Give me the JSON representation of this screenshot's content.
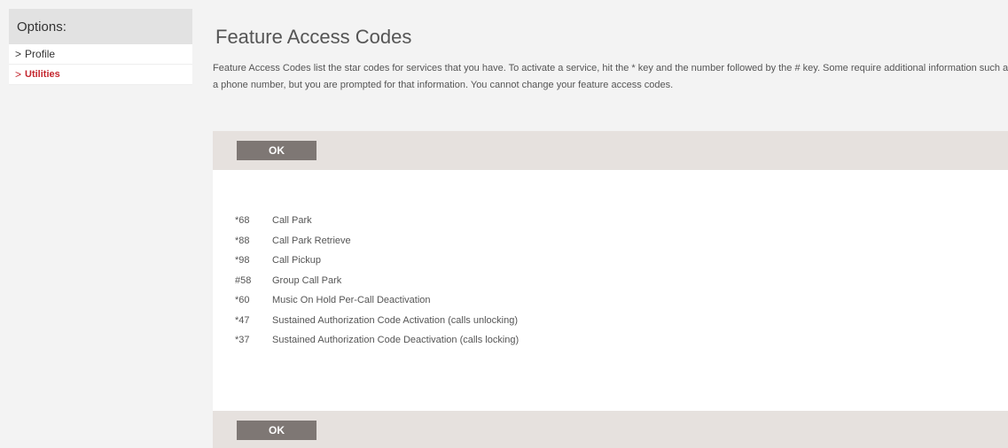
{
  "sidebar": {
    "header": "Options:",
    "items": [
      {
        "label": "Profile",
        "active": false
      },
      {
        "label": "Utilities",
        "active": true
      }
    ]
  },
  "main": {
    "title": "Feature Access Codes",
    "description": "Feature Access Codes list the star codes for services that you have. To activate a service, hit the * key and the number followed by the # key. Some require additional information such as a phone number, but you are prompted for that information. You cannot change your feature access codes.",
    "ok_label": "OK",
    "codes": [
      {
        "code": "*68",
        "name": "Call Park"
      },
      {
        "code": "*88",
        "name": "Call Park Retrieve"
      },
      {
        "code": "*98",
        "name": "Call Pickup"
      },
      {
        "code": "#58",
        "name": "Group Call Park"
      },
      {
        "code": "*60",
        "name": "Music On Hold Per-Call Deactivation"
      },
      {
        "code": "*47",
        "name": "Sustained Authorization Code Activation (calls unlocking)"
      },
      {
        "code": "*37",
        "name": "Sustained Authorization Code Deactivation (calls locking)"
      }
    ]
  },
  "colors": {
    "accent": "#c4262e",
    "button": "#7e7774",
    "bar": "#e6e1de",
    "background": "#f3f3f3"
  }
}
